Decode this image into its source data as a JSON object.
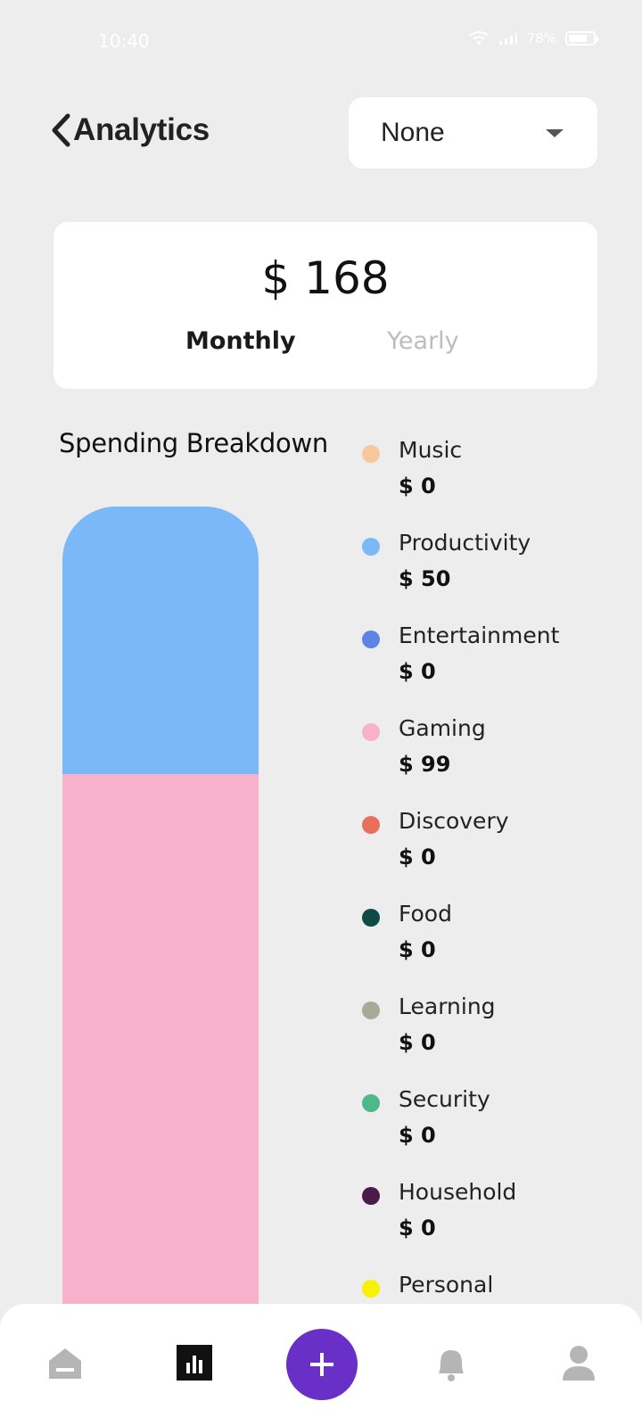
{
  "status_bar": {
    "time": "10:40",
    "battery": "78%",
    "battery_level": 0.78
  },
  "header": {
    "back_icon": "chevron-left-icon",
    "title": "Analytics"
  },
  "filter": {
    "selected": "None",
    "icon": "caret-down-icon"
  },
  "summary": {
    "total": "$ 168",
    "tabs": [
      "Monthly",
      "Yearly"
    ],
    "active_tab": "Monthly"
  },
  "breakdown": {
    "title": "Spending Breakdown",
    "categories": [
      {
        "name": "Music",
        "amount": "$ 0",
        "color": "#f7c89b"
      },
      {
        "name": "Productivity",
        "amount": "$ 50",
        "color": "#7bb8f7"
      },
      {
        "name": "Entertainment",
        "amount": "$ 0",
        "color": "#5b84e8"
      },
      {
        "name": "Gaming",
        "amount": "$ 99",
        "color": "#f7b1cb"
      },
      {
        "name": "Discovery",
        "amount": "$ 0",
        "color": "#e8705a"
      },
      {
        "name": "Food",
        "amount": "$ 0",
        "color": "#0f4a47"
      },
      {
        "name": "Learning",
        "amount": "$ 0",
        "color": "#a7ab96"
      },
      {
        "name": "Security",
        "amount": "$ 0",
        "color": "#4db888"
      },
      {
        "name": "Household",
        "amount": "$ 0",
        "color": "#4a1a4a"
      },
      {
        "name": "Personal",
        "amount": "",
        "color": "#f7f200"
      }
    ]
  },
  "chart_data": {
    "type": "bar",
    "stacked": true,
    "categories": [
      "Spending"
    ],
    "series": [
      {
        "name": "Productivity",
        "values": [
          50
        ],
        "color": "#7bb8f7"
      },
      {
        "name": "Gaming",
        "values": [
          99
        ],
        "color": "#f7b1cb"
      }
    ]
  },
  "bottom_nav": {
    "items": [
      {
        "icon": "home-icon",
        "active": false
      },
      {
        "icon": "analytics-icon",
        "active": true
      },
      {
        "icon": "add-icon",
        "active": false
      },
      {
        "icon": "bell-icon",
        "active": false
      },
      {
        "icon": "profile-icon",
        "active": false
      }
    ],
    "accent": "#6a2fc7"
  }
}
